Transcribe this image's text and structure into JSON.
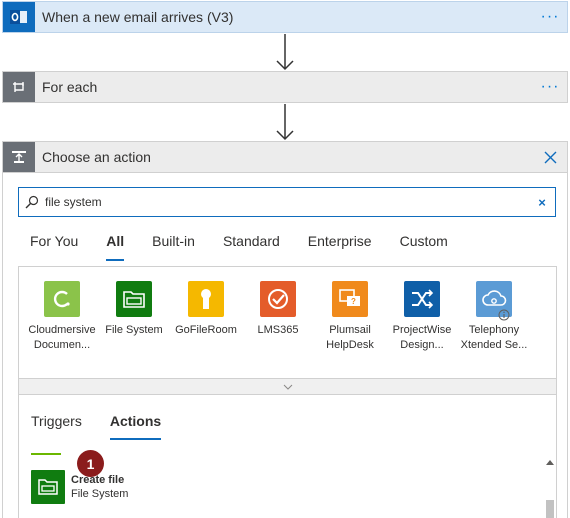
{
  "trigger": {
    "title": "When a new email arrives (V3)",
    "icon": "outlook-icon",
    "more": "···"
  },
  "for_each": {
    "title": "For each",
    "icon": "loop-icon",
    "more": "···"
  },
  "choose_action": {
    "title": "Choose an action",
    "icon": "action-icon",
    "close_icon": "close-icon"
  },
  "search": {
    "value": "file system",
    "icon": "search-icon",
    "clear_icon": "clear-icon"
  },
  "filter_tabs": [
    {
      "label": "For You",
      "active": false
    },
    {
      "label": "All",
      "active": true
    },
    {
      "label": "Built-in",
      "active": false
    },
    {
      "label": "Standard",
      "active": false
    },
    {
      "label": "Enterprise",
      "active": false
    },
    {
      "label": "Custom",
      "active": false
    }
  ],
  "connectors": [
    {
      "label": "Cloudmersive Documen...",
      "color": "#8bc34a"
    },
    {
      "label": "File System",
      "color": "#107c10"
    },
    {
      "label": "GoFileRoom",
      "color": "#f5b800"
    },
    {
      "label": "LMS365",
      "color": "#e45c2a"
    },
    {
      "label": "Plumsail HelpDesk",
      "color": "#f08a1c"
    },
    {
      "label": "ProjectWise Design...",
      "color": "#0f5fa8"
    },
    {
      "label": "Telephony Xtended Se...",
      "color": "#5b9bd5"
    }
  ],
  "result_tabs": [
    {
      "label": "Triggers",
      "active": false
    },
    {
      "label": "Actions",
      "active": true
    }
  ],
  "step_badge": "1",
  "action": {
    "name": "Create file",
    "connector": "File System"
  },
  "colors": {
    "accent": "#0f6cbd",
    "badge": "#8b1c1c",
    "file_system": "#107c10"
  }
}
